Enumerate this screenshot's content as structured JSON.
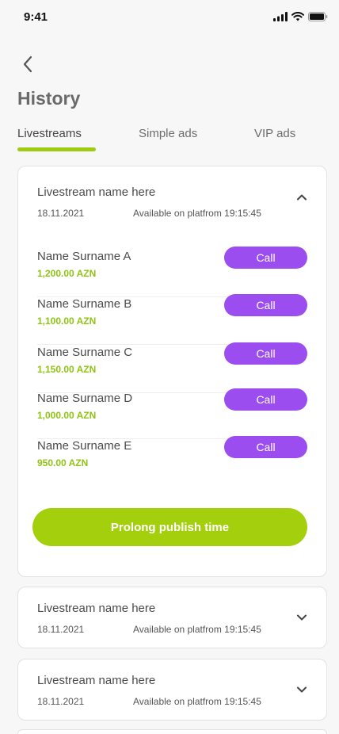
{
  "status_bar": {
    "time": "9:41"
  },
  "header": {
    "title": "History"
  },
  "tabs": [
    {
      "label": "Livestreams",
      "active": true
    },
    {
      "label": "Simple ads",
      "active": false
    },
    {
      "label": "VIP ads",
      "active": false
    }
  ],
  "expanded_card": {
    "title": "Livestream name here",
    "date": "18.11.2021",
    "availability": "Available on platfrom 19:15:45",
    "bidders": [
      {
        "name": "Name Surname A",
        "amount": "1,200.00 AZN",
        "call_label": "Call"
      },
      {
        "name": "Name Surname B",
        "amount": "1,100.00 AZN",
        "call_label": "Call"
      },
      {
        "name": "Name Surname C",
        "amount": "1,150.00 AZN",
        "call_label": "Call"
      },
      {
        "name": "Name Surname D",
        "amount": "1,000.00 AZN",
        "call_label": "Call"
      },
      {
        "name": "Name Surname E",
        "amount": "950.00 AZN",
        "call_label": "Call"
      }
    ],
    "prolong_label": "Prolong publish time"
  },
  "collapsed_cards": [
    {
      "title": "Livestream name here",
      "date": "18.11.2021",
      "availability": "Available on platfrom 19:15:45"
    },
    {
      "title": "Livestream name here",
      "date": "18.11.2021",
      "availability": "Available on platfrom 19:15:45"
    }
  ],
  "colors": {
    "accent_green": "#a3cf0c",
    "call_purple": "#9b4df0",
    "amount_green": "#8fc414"
  }
}
